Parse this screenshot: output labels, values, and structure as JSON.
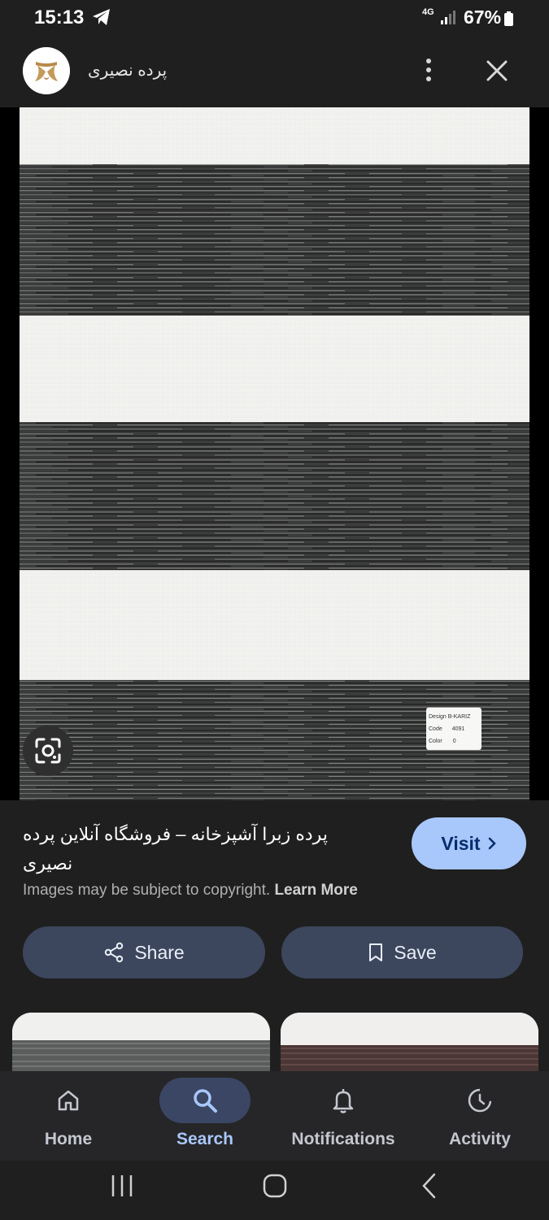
{
  "status_bar": {
    "time": "15:13",
    "network": "4G",
    "battery": "67%",
    "icons": [
      "telegram-icon",
      "signal-icon",
      "battery-icon"
    ]
  },
  "top_bar": {
    "site_name": "پرده نصیری",
    "icons": [
      "site-logo",
      "more-vert-icon",
      "close-icon"
    ]
  },
  "image": {
    "label_card": {
      "design_label": "Design",
      "design_value": "B-KARIZ",
      "code_label": "Code",
      "code_value": "4091",
      "color_label": "Color",
      "color_value": "0"
    },
    "lens_icon": "google-lens-icon"
  },
  "result": {
    "title": "پرده زبرا آشپزخانه – فروشگاه آنلاین پرده نصیری",
    "visit_label": "Visit",
    "copyright_text": "Images may be subject to copyright.",
    "learn_more": "Learn More"
  },
  "actions": {
    "share_label": "Share",
    "save_label": "Save"
  },
  "bottom_nav": {
    "items": [
      {
        "label": "Home",
        "icon": "home-icon",
        "active": false
      },
      {
        "label": "Search",
        "icon": "search-icon",
        "active": true
      },
      {
        "label": "Notifications",
        "icon": "bell-icon",
        "active": false
      },
      {
        "label": "Activity",
        "icon": "activity-icon",
        "active": false
      }
    ]
  },
  "system_nav": [
    "recents-icon",
    "home-circle-icon",
    "back-icon"
  ],
  "colors": {
    "background": "#1f1f1f",
    "accent": "#a8c7fa",
    "button_bg": "#3c475d",
    "nav_active_bg": "#3a4663"
  }
}
